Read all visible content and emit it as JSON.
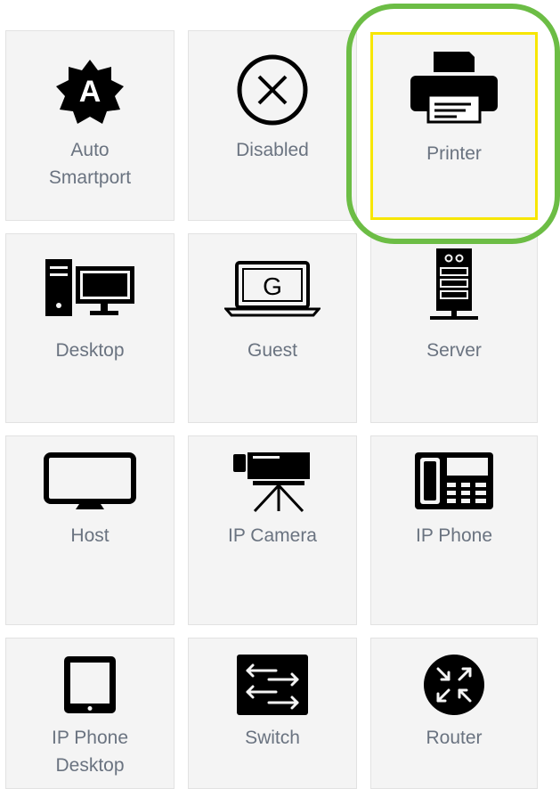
{
  "tiles": [
    {
      "label": "Auto\nSmartport",
      "icon": "auto-smartport-icon"
    },
    {
      "label": "Disabled",
      "icon": "disabled-icon"
    },
    {
      "label": "Printer",
      "icon": "printer-icon",
      "selected": true
    },
    {
      "label": "Desktop",
      "icon": "desktop-icon"
    },
    {
      "label": "Guest",
      "icon": "guest-laptop-icon",
      "icon_text": "G"
    },
    {
      "label": "Server",
      "icon": "server-icon"
    },
    {
      "label": "Host",
      "icon": "host-monitor-icon"
    },
    {
      "label": "IP Camera",
      "icon": "ip-camera-icon"
    },
    {
      "label": "IP Phone",
      "icon": "ip-phone-icon"
    },
    {
      "label": "IP Phone\nDesktop",
      "icon": "ip-phone-desktop-icon"
    },
    {
      "label": "Switch",
      "icon": "switch-icon"
    },
    {
      "label": "Router",
      "icon": "router-icon"
    }
  ],
  "colors": {
    "highlight": "#6cbd45",
    "selected_border": "#f7e600",
    "label": "#6a7380"
  }
}
